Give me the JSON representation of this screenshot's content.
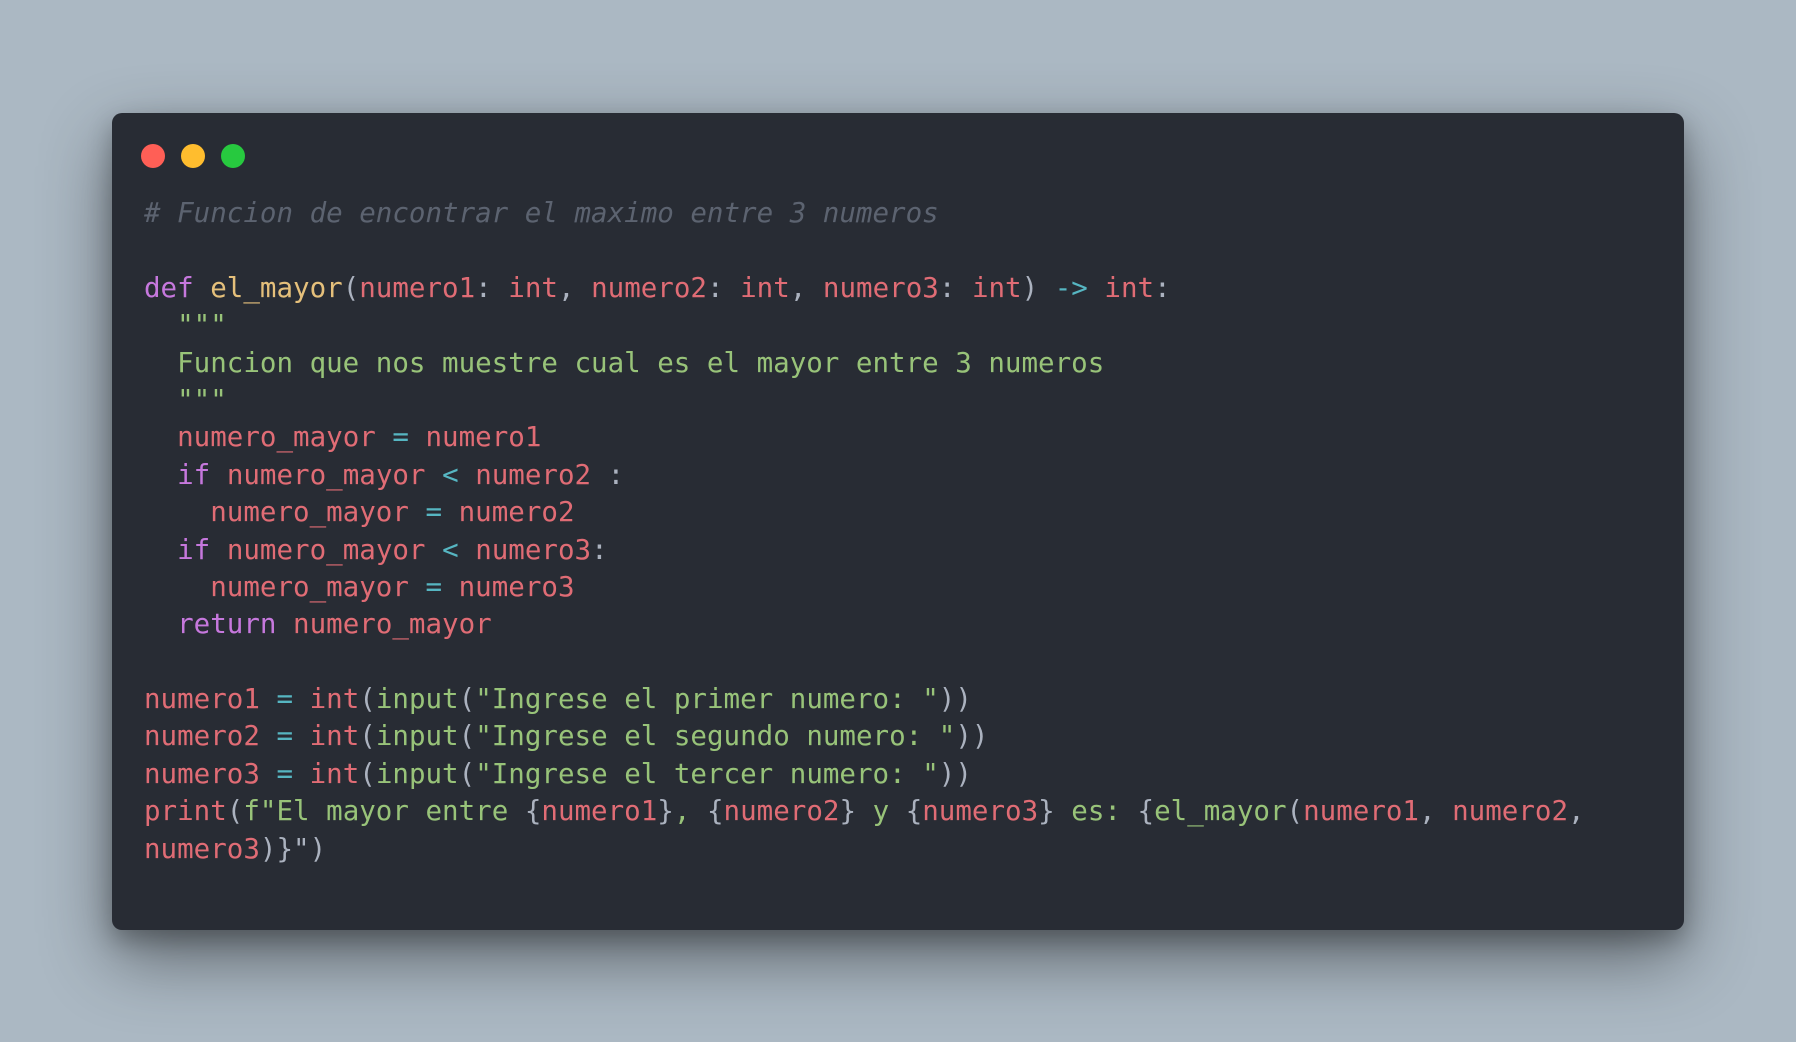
{
  "window": {
    "controls": [
      {
        "name": "close",
        "color": "#ff5f56"
      },
      {
        "name": "minimize",
        "color": "#ffbd2e"
      },
      {
        "name": "maximize",
        "color": "#27c93f"
      }
    ]
  },
  "colors": {
    "background": "#abb8c3",
    "editor_bg": "#282c34",
    "comment": "#5c6370",
    "keyword": "#c678dd",
    "function": "#e5c07b",
    "variable": "#e06c75",
    "string": "#98c379",
    "operator": "#56b6c2",
    "plain": "#abb2bf"
  },
  "code": {
    "language": "python",
    "lines": [
      [
        {
          "t": "# Funcion de encontrar el maximo entre 3 numeros",
          "k": "comment"
        }
      ],
      [],
      [
        {
          "t": "def",
          "k": "keyword"
        },
        {
          "t": " ",
          "k": "plain"
        },
        {
          "t": "el_mayor",
          "k": "function"
        },
        {
          "t": "(",
          "k": "plain"
        },
        {
          "t": "numero1",
          "k": "variable"
        },
        {
          "t": ": ",
          "k": "plain"
        },
        {
          "t": "int",
          "k": "variable"
        },
        {
          "t": ", ",
          "k": "plain"
        },
        {
          "t": "numero2",
          "k": "variable"
        },
        {
          "t": ": ",
          "k": "plain"
        },
        {
          "t": "int",
          "k": "variable"
        },
        {
          "t": ", ",
          "k": "plain"
        },
        {
          "t": "numero3",
          "k": "variable"
        },
        {
          "t": ": ",
          "k": "plain"
        },
        {
          "t": "int",
          "k": "variable"
        },
        {
          "t": ") ",
          "k": "plain"
        },
        {
          "t": "->",
          "k": "operator"
        },
        {
          "t": " ",
          "k": "plain"
        },
        {
          "t": "int",
          "k": "variable"
        },
        {
          "t": ":",
          "k": "plain"
        }
      ],
      [
        {
          "t": "  \"\"\"",
          "k": "string"
        }
      ],
      [
        {
          "t": "  Funcion que nos muestre cual es el mayor entre 3 numeros",
          "k": "string"
        }
      ],
      [
        {
          "t": "  \"\"\"",
          "k": "string"
        }
      ],
      [
        {
          "t": "  ",
          "k": "plain"
        },
        {
          "t": "numero_mayor",
          "k": "variable"
        },
        {
          "t": " ",
          "k": "plain"
        },
        {
          "t": "=",
          "k": "operator"
        },
        {
          "t": " ",
          "k": "plain"
        },
        {
          "t": "numero1",
          "k": "variable"
        }
      ],
      [
        {
          "t": "  ",
          "k": "plain"
        },
        {
          "t": "if",
          "k": "keyword"
        },
        {
          "t": " ",
          "k": "plain"
        },
        {
          "t": "numero_mayor",
          "k": "variable"
        },
        {
          "t": " ",
          "k": "plain"
        },
        {
          "t": "<",
          "k": "operator"
        },
        {
          "t": " ",
          "k": "plain"
        },
        {
          "t": "numero2",
          "k": "variable"
        },
        {
          "t": " :",
          "k": "plain"
        }
      ],
      [
        {
          "t": "    ",
          "k": "plain"
        },
        {
          "t": "numero_mayor",
          "k": "variable"
        },
        {
          "t": " ",
          "k": "plain"
        },
        {
          "t": "=",
          "k": "operator"
        },
        {
          "t": " ",
          "k": "plain"
        },
        {
          "t": "numero2",
          "k": "variable"
        }
      ],
      [
        {
          "t": "  ",
          "k": "plain"
        },
        {
          "t": "if",
          "k": "keyword"
        },
        {
          "t": " ",
          "k": "plain"
        },
        {
          "t": "numero_mayor",
          "k": "variable"
        },
        {
          "t": " ",
          "k": "plain"
        },
        {
          "t": "<",
          "k": "operator"
        },
        {
          "t": " ",
          "k": "plain"
        },
        {
          "t": "numero3",
          "k": "variable"
        },
        {
          "t": ":",
          "k": "plain"
        }
      ],
      [
        {
          "t": "    ",
          "k": "plain"
        },
        {
          "t": "numero_mayor",
          "k": "variable"
        },
        {
          "t": " ",
          "k": "plain"
        },
        {
          "t": "=",
          "k": "operator"
        },
        {
          "t": " ",
          "k": "plain"
        },
        {
          "t": "numero3",
          "k": "variable"
        }
      ],
      [
        {
          "t": "  ",
          "k": "plain"
        },
        {
          "t": "return",
          "k": "keyword"
        },
        {
          "t": " ",
          "k": "plain"
        },
        {
          "t": "numero_mayor",
          "k": "variable"
        }
      ],
      [],
      [
        {
          "t": "numero1",
          "k": "variable"
        },
        {
          "t": " ",
          "k": "plain"
        },
        {
          "t": "=",
          "k": "operator"
        },
        {
          "t": " ",
          "k": "plain"
        },
        {
          "t": "int",
          "k": "variable"
        },
        {
          "t": "(",
          "k": "plain"
        },
        {
          "t": "input",
          "k": "string"
        },
        {
          "t": "(",
          "k": "plain"
        },
        {
          "t": "\"Ingrese el primer numero: \"",
          "k": "string"
        },
        {
          "t": "))",
          "k": "plain"
        }
      ],
      [
        {
          "t": "numero2",
          "k": "variable"
        },
        {
          "t": " ",
          "k": "plain"
        },
        {
          "t": "=",
          "k": "operator"
        },
        {
          "t": " ",
          "k": "plain"
        },
        {
          "t": "int",
          "k": "variable"
        },
        {
          "t": "(",
          "k": "plain"
        },
        {
          "t": "input",
          "k": "string"
        },
        {
          "t": "(",
          "k": "plain"
        },
        {
          "t": "\"Ingrese el segundo numero: \"",
          "k": "string"
        },
        {
          "t": "))",
          "k": "plain"
        }
      ],
      [
        {
          "t": "numero3",
          "k": "variable"
        },
        {
          "t": " ",
          "k": "plain"
        },
        {
          "t": "=",
          "k": "operator"
        },
        {
          "t": " ",
          "k": "plain"
        },
        {
          "t": "int",
          "k": "variable"
        },
        {
          "t": "(",
          "k": "plain"
        },
        {
          "t": "input",
          "k": "string"
        },
        {
          "t": "(",
          "k": "plain"
        },
        {
          "t": "\"Ingrese el tercer numero: \"",
          "k": "string"
        },
        {
          "t": "))",
          "k": "plain"
        }
      ],
      [
        {
          "t": "print",
          "k": "variable"
        },
        {
          "t": "(",
          "k": "plain"
        },
        {
          "t": "f\"El mayor entre ",
          "k": "string"
        },
        {
          "t": "{",
          "k": "plain"
        },
        {
          "t": "numero1",
          "k": "variable"
        },
        {
          "t": "}",
          "k": "plain"
        },
        {
          "t": ", ",
          "k": "string"
        },
        {
          "t": "{",
          "k": "plain"
        },
        {
          "t": "numero2",
          "k": "variable"
        },
        {
          "t": "}",
          "k": "plain"
        },
        {
          "t": " y ",
          "k": "string"
        },
        {
          "t": "{",
          "k": "plain"
        },
        {
          "t": "numero3",
          "k": "variable"
        },
        {
          "t": "}",
          "k": "plain"
        },
        {
          "t": " es: ",
          "k": "string"
        },
        {
          "t": "{",
          "k": "plain"
        },
        {
          "t": "el_mayor",
          "k": "string"
        },
        {
          "t": "(",
          "k": "plain"
        },
        {
          "t": "numero1",
          "k": "variable"
        },
        {
          "t": ", ",
          "k": "plain"
        },
        {
          "t": "numero2",
          "k": "variable"
        },
        {
          "t": ",",
          "k": "plain"
        }
      ],
      [
        {
          "t": "numero3",
          "k": "variable"
        },
        {
          "t": ")}\"",
          "k": "plain"
        },
        {
          "t": ")",
          "k": "plain"
        }
      ]
    ]
  }
}
